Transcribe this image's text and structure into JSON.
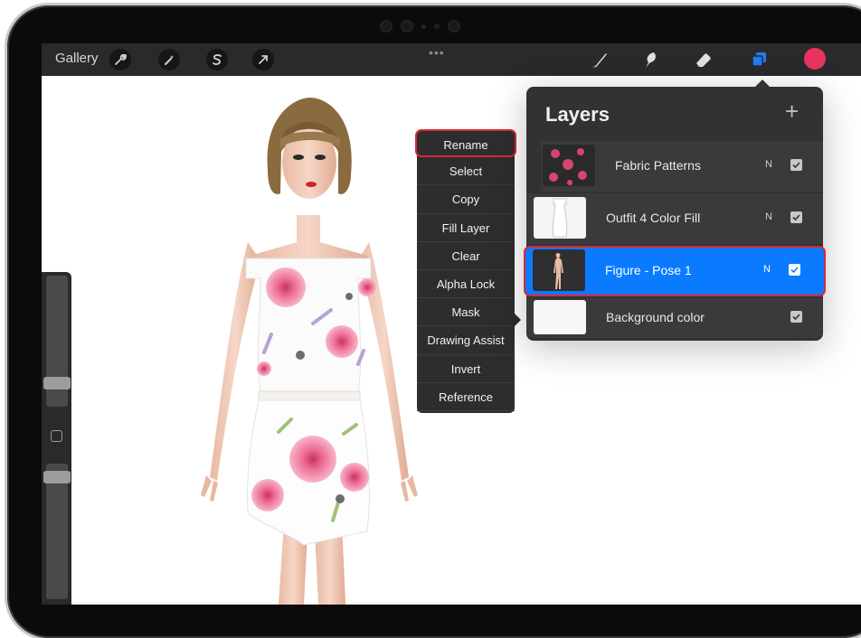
{
  "toolbar": {
    "gallery_label": "Gallery",
    "more_dots": "•••",
    "tools": [
      "wrench-icon",
      "magic-wand-icon",
      "selection-s-icon",
      "transform-arrow-icon"
    ],
    "right_tools": [
      "brush-icon",
      "smudge-icon",
      "eraser-icon",
      "layers-icon"
    ],
    "current_color": "#e8335e"
  },
  "context_menu": {
    "items": [
      "Rename",
      "Select",
      "Copy",
      "Fill Layer",
      "Clear",
      "Alpha Lock",
      "Mask",
      "Drawing Assist",
      "Invert",
      "Reference"
    ]
  },
  "layers": {
    "title": "Layers",
    "add_label": "+",
    "rows": [
      {
        "name": "Fabric Patterns",
        "blend": "N",
        "visible": true,
        "clipped": true,
        "selected": false
      },
      {
        "name": "Outfit 4 Color Fill",
        "blend": "N",
        "visible": true,
        "clipped": false,
        "selected": false
      },
      {
        "name": "Figure - Pose 1",
        "blend": "N",
        "visible": true,
        "clipped": false,
        "selected": true
      },
      {
        "name": "Background color",
        "blend": "",
        "visible": true,
        "clipped": false,
        "selected": false
      }
    ]
  },
  "colors": {
    "selection_blue": "#0a7bff",
    "highlight_red": "#e0262f",
    "toolbar_bg": "#2a2a2c"
  }
}
